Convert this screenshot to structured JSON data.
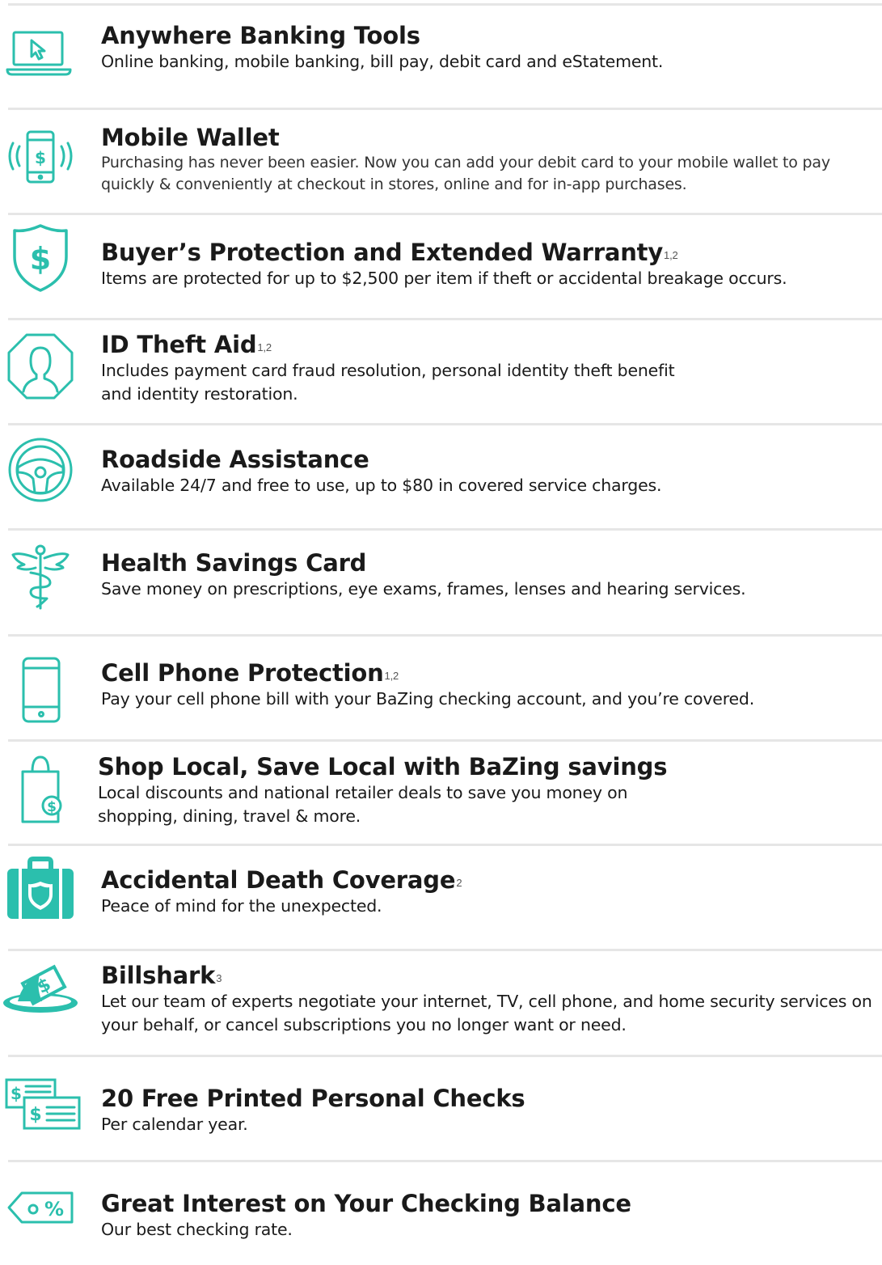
{
  "accent_color": "#2bbfad",
  "features": [
    {
      "icon": "laptop-cursor-icon",
      "title": "Anywhere Banking Tools",
      "sup": "",
      "description": "Online banking, mobile banking, bill pay, debit card and eStatement."
    },
    {
      "icon": "mobile-wallet-icon",
      "title": "Mobile Wallet",
      "sup": "",
      "description": "Purchasing has never been easier. Now you can add your debit card to your mobile wallet to pay quickly & conveniently at checkout in stores, online and for in-app purchases."
    },
    {
      "icon": "shield-dollar-icon",
      "title": "Buyer’s Protection and Extended Warranty",
      "sup": "1,2",
      "description": "Items are protected for up to $2,500 per item if theft or accidental breakage occurs."
    },
    {
      "icon": "person-octagon-icon",
      "title": "ID Theft Aid",
      "sup": "1,2",
      "description": "Includes payment card fraud resolution, personal identity theft benefit and identity restoration."
    },
    {
      "icon": "steering-wheel-icon",
      "title": "Roadside Assistance",
      "sup": "",
      "description": "Available 24/7 and free to use, up to $80 in covered service charges."
    },
    {
      "icon": "caduceus-icon",
      "title": "Health Savings Card",
      "sup": "",
      "description": "Save money on prescriptions, eye exams, frames, lenses and hearing services."
    },
    {
      "icon": "cell-phone-icon",
      "title": "Cell Phone Protection",
      "sup": "1,2",
      "description": "Pay your cell phone bill with your BaZing checking account, and you’re covered."
    },
    {
      "icon": "shopping-bag-icon",
      "title": "Shop Local, Save Local with BaZing savings",
      "sup": "",
      "description": "Local discounts and national retailer deals to save you money on shopping, dining, travel & more."
    },
    {
      "icon": "briefcase-shield-icon",
      "title": "Accidental Death Coverage",
      "sup": "2",
      "description": "Peace of mind for the unexpected."
    },
    {
      "icon": "shark-fin-icon",
      "title": "Billshark",
      "sup": "3",
      "description": "Let our team of experts negotiate your internet, TV, cell phone, and home security services on your behalf, or cancel subscriptions you no longer want or need."
    },
    {
      "icon": "checks-icon",
      "title": "20 Free Printed Personal Checks",
      "sup": "",
      "description": "Per calendar year."
    },
    {
      "icon": "percent-tag-icon",
      "title": "Great Interest on Your Checking Balance",
      "sup": "",
      "description": "Our best checking rate."
    }
  ]
}
